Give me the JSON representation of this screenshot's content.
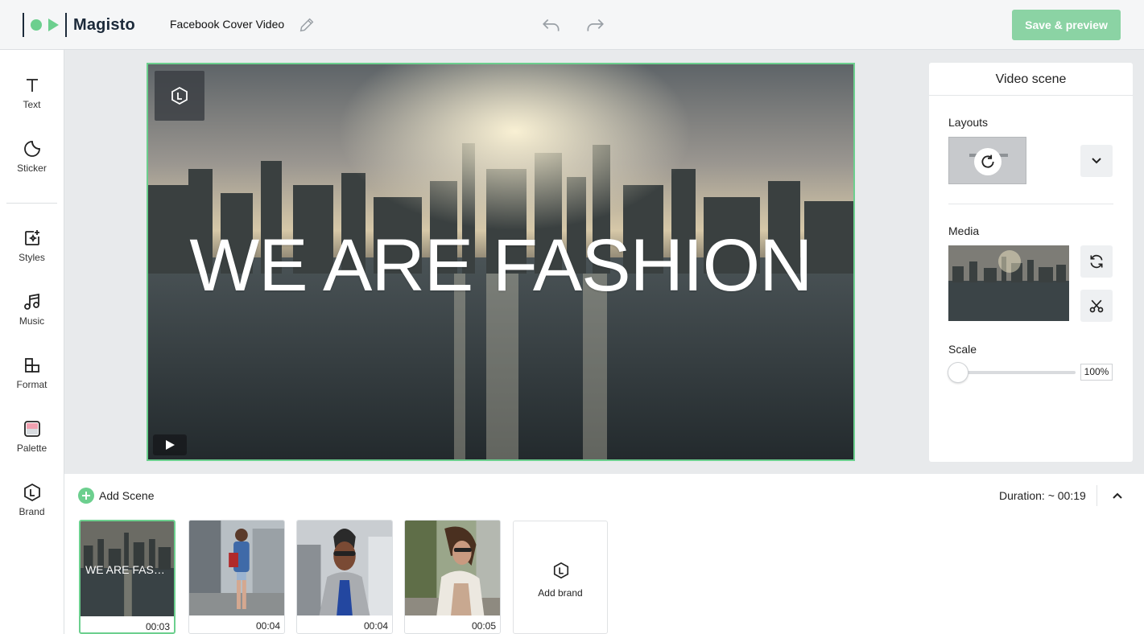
{
  "app": {
    "brand": "Magisto",
    "project_title": "Facebook Cover Video",
    "save_label": "Save & preview"
  },
  "tools": [
    {
      "label": "Text",
      "icon": "text-icon"
    },
    {
      "label": "Sticker",
      "icon": "sticker-icon"
    },
    {
      "label": "Styles",
      "icon": "styles-icon"
    },
    {
      "label": "Music",
      "icon": "music-icon"
    },
    {
      "label": "Format",
      "icon": "format-icon"
    },
    {
      "label": "Palette",
      "icon": "palette-icon"
    },
    {
      "label": "Brand",
      "icon": "brand-icon"
    }
  ],
  "preview": {
    "headline": "WE ARE FASHION"
  },
  "panel": {
    "title": "Video scene",
    "layouts_label": "Layouts",
    "media_label": "Media",
    "scale_label": "Scale",
    "scale_value": "100%",
    "scale_level": 0
  },
  "timeline": {
    "add_scene": "Add Scene",
    "duration": "Duration: ~ 00:19",
    "clips": [
      {
        "caption": "WE ARE FASHION",
        "time": "00:03",
        "active": true
      },
      {
        "caption": "",
        "time": "00:04",
        "active": false
      },
      {
        "caption": "",
        "time": "00:04",
        "active": false
      },
      {
        "caption": "",
        "time": "00:05",
        "active": false
      }
    ],
    "add_brand": "Add brand"
  },
  "colors": {
    "accent": "#6ccf8e",
    "save_button": "#8bd3a4",
    "brand_text": "#1c2a3a"
  }
}
